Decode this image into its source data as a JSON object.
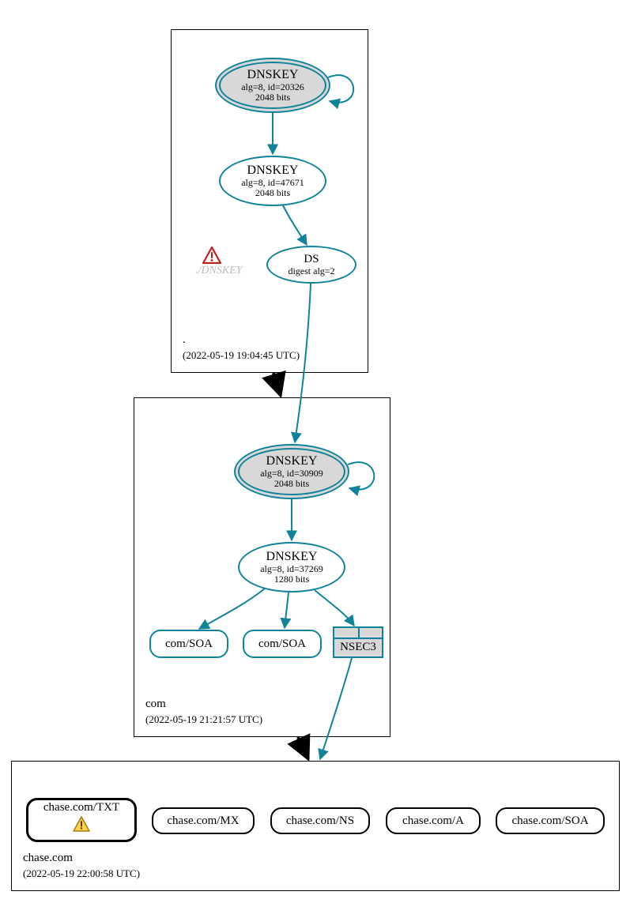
{
  "zones": {
    "root": {
      "label": ".",
      "timestamp": "(2022-05-19 19:04:45 UTC)",
      "dnskey_primary": {
        "title": "DNSKEY",
        "sub1": "alg=8, id=20326",
        "sub2": "2048 bits"
      },
      "dnskey_secondary": {
        "title": "DNSKEY",
        "sub1": "alg=8, id=47671",
        "sub2": "2048 bits"
      },
      "ds": {
        "title": "DS",
        "sub1": "digest alg=2"
      },
      "ghost_label": "./DNSKEY"
    },
    "com": {
      "label": "com",
      "timestamp": "(2022-05-19 21:21:57 UTC)",
      "dnskey_primary": {
        "title": "DNSKEY",
        "sub1": "alg=8, id=30909",
        "sub2": "2048 bits"
      },
      "dnskey_secondary": {
        "title": "DNSKEY",
        "sub1": "alg=8, id=37269",
        "sub2": "1280 bits"
      },
      "soa1": "com/SOA",
      "soa2": "com/SOA",
      "nsec3": "NSEC3"
    },
    "chase": {
      "label": "chase.com",
      "timestamp": "(2022-05-19 22:00:58 UTC)",
      "txt": "chase.com/TXT",
      "mx": "chase.com/MX",
      "ns": "chase.com/NS",
      "a": "chase.com/A",
      "soa": "chase.com/SOA"
    }
  }
}
